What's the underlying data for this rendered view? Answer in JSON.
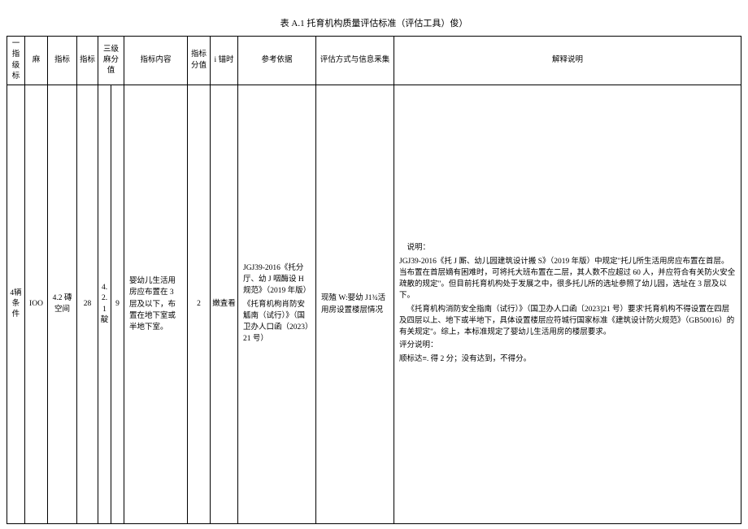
{
  "title": "表 A.1 托育机构质量评估标准（评估工具）俊）",
  "headers": {
    "level1": "一指级标",
    "level1_value": "麻",
    "level2": "指标",
    "level2_value": "指标",
    "level3": "三级麻分值",
    "content": "指标内容",
    "item_value": "指标分值",
    "timing": "i 锚时",
    "reference": "参考依据",
    "method": "评估方式与信息釆集",
    "explain": "解释说明"
  },
  "row": {
    "level1": "4辆条件",
    "level1_value": "IOO",
    "level2": "4.2 磚空间",
    "level2_value": "28",
    "level3": "4.2.1 靛",
    "level3_value": "9",
    "content": "婴幼儿生活用房应布置在 3 层及以下，布置在地下室或半地下室。",
    "item_value": "2",
    "timing": "嫩査看",
    "reference_p1": "JGJ39-2016《托分厅、幼 J 咽酶设 H 规范》（2019 年版）",
    "reference_p2": "《托育机枸肖防安觚南（试行）》（国卫办人口函（2023）21 号）",
    "method": "现殖 W:婴幼 J1¾活用房设置楼层情况",
    "explain_l1": "说明：",
    "explain_p1": "JGJ39-2016《托 J 厮、幼儿园建筑设计搬 S》（2019 年版）中规定\"托儿所生活用房应布置在首层。当布置在首层嫡有困难时，可将托大班布置在二层，其人数不应超过 60 人，并应符合有关防火安全疏散的规定\"。但目前托育机构处于发展之中，很多托儿所的选址参照了幼儿园，选址在 3 层及以下。",
    "explain_p2": "《托育机构消防安全指南（试行）》（国卫办人口函〔2023]21 号）要求'托育机构不得设置在四层及四层以上、地下或半地下，具体设置楼层应符城行国家标准《建筑设计防火规范》（GB50016）的有关规定\"。综上，本标准规定了婴幼儿生活用房的楼层要求。",
    "explain_l2": "评分说明：",
    "explain_p3": "顺标达≡. 得 2 分；没有达到，不得分。"
  }
}
